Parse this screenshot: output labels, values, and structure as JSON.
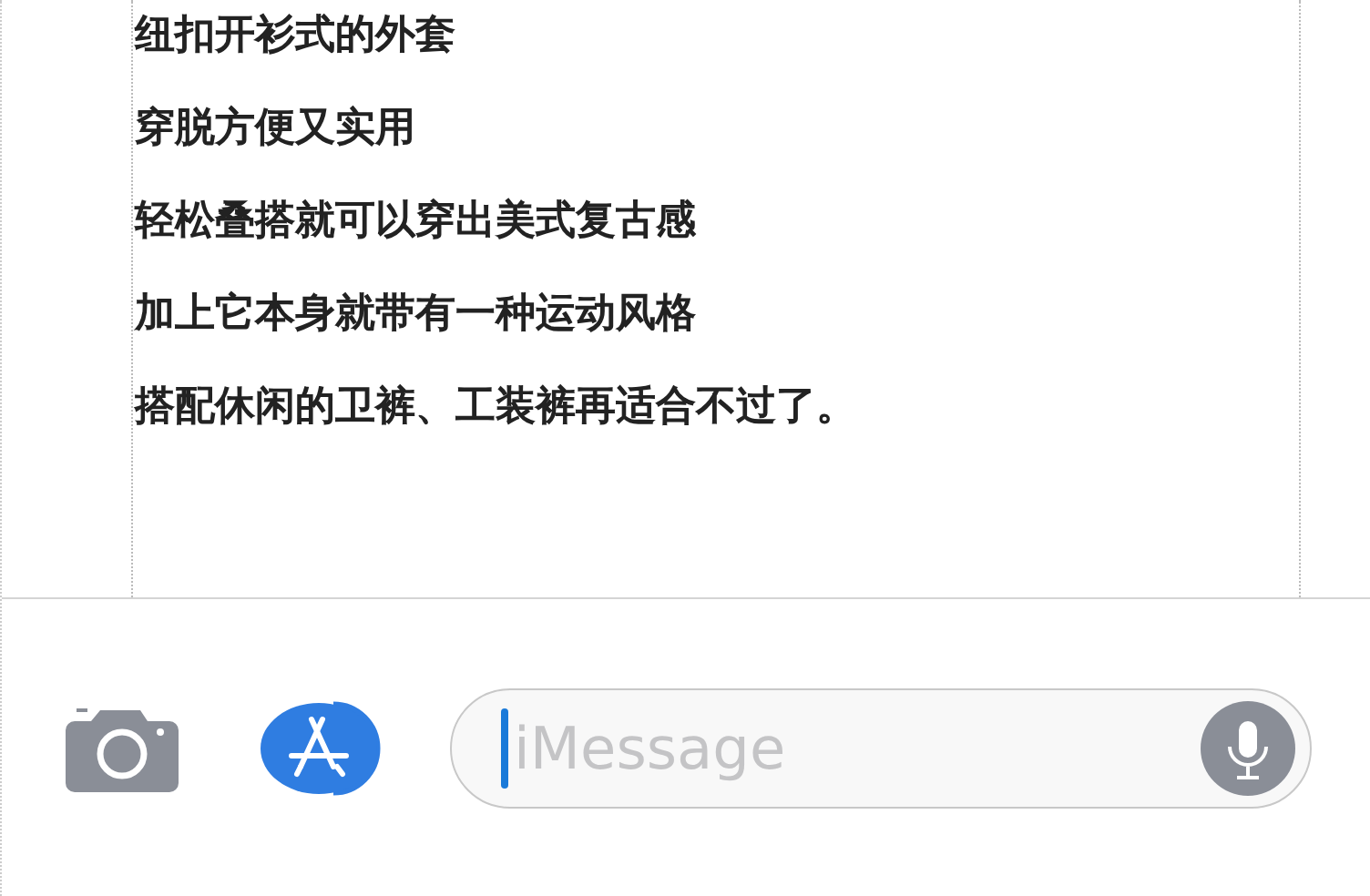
{
  "article": {
    "lines": [
      "纽扣开衫式的外套",
      "穿脱方便又实用",
      "轻松叠搭就可以穿出美式复古感",
      "加上它本身就带有一种运动风格",
      "搭配休闲的卫裤、工装裤再适合不过了。"
    ]
  },
  "compose_bar": {
    "placeholder": "iMessage"
  }
}
